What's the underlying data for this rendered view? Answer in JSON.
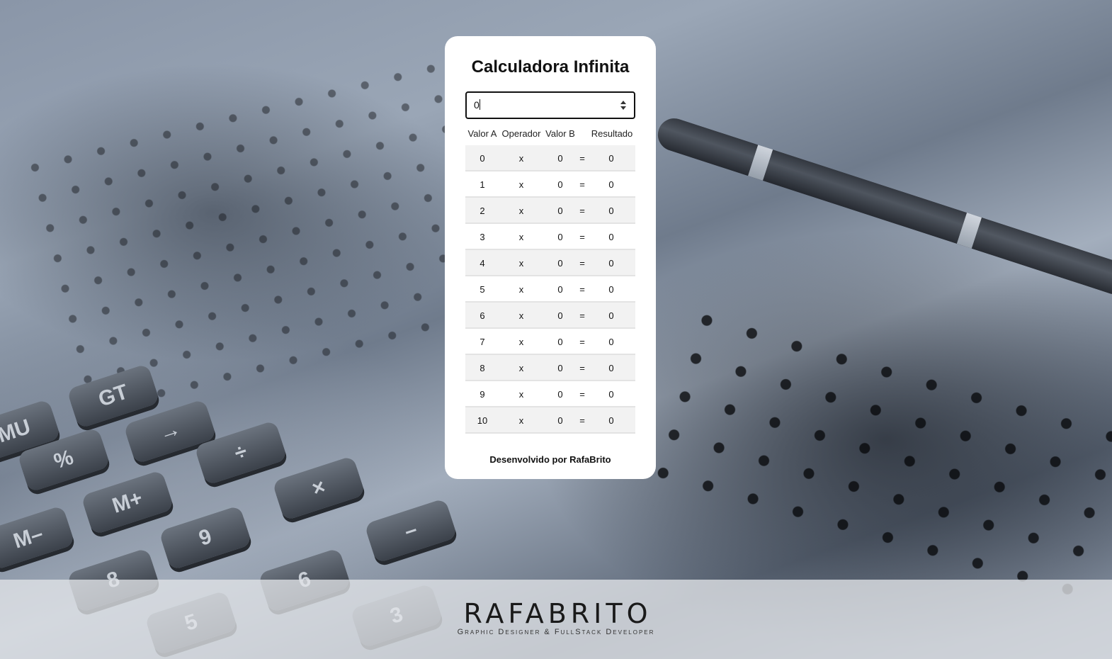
{
  "app": {
    "title": "Calculadora Infinita",
    "input_value": "0",
    "credit": "Desenvolvido por RafaBrito"
  },
  "table": {
    "headers": {
      "a": "Valor A",
      "op": "Operador",
      "b": "Valor B",
      "result": "Resultado"
    },
    "rows": [
      {
        "a": "0",
        "op": "x",
        "b": "0",
        "eq": "=",
        "result": "0"
      },
      {
        "a": "1",
        "op": "x",
        "b": "0",
        "eq": "=",
        "result": "0"
      },
      {
        "a": "2",
        "op": "x",
        "b": "0",
        "eq": "=",
        "result": "0"
      },
      {
        "a": "3",
        "op": "x",
        "b": "0",
        "eq": "=",
        "result": "0"
      },
      {
        "a": "4",
        "op": "x",
        "b": "0",
        "eq": "=",
        "result": "0"
      },
      {
        "a": "5",
        "op": "x",
        "b": "0",
        "eq": "=",
        "result": "0"
      },
      {
        "a": "6",
        "op": "x",
        "b": "0",
        "eq": "=",
        "result": "0"
      },
      {
        "a": "7",
        "op": "x",
        "b": "0",
        "eq": "=",
        "result": "0"
      },
      {
        "a": "8",
        "op": "x",
        "b": "0",
        "eq": "=",
        "result": "0"
      },
      {
        "a": "9",
        "op": "x",
        "b": "0",
        "eq": "=",
        "result": "0"
      },
      {
        "a": "10",
        "op": "x",
        "b": "0",
        "eq": "=",
        "result": "0"
      }
    ]
  },
  "footer": {
    "logo": "RAFABRITO",
    "tagline": "Graphic Designer & FullStack Developer"
  },
  "background": {
    "keys": [
      "GT",
      "MU",
      "→",
      "%",
      "÷",
      "M+",
      "×",
      "M–",
      "9",
      "–",
      "8",
      "6",
      "5",
      "3"
    ]
  },
  "colors": {
    "card_bg": "#ffffff",
    "row_shade": "#f2f2f2",
    "text": "#111111"
  }
}
